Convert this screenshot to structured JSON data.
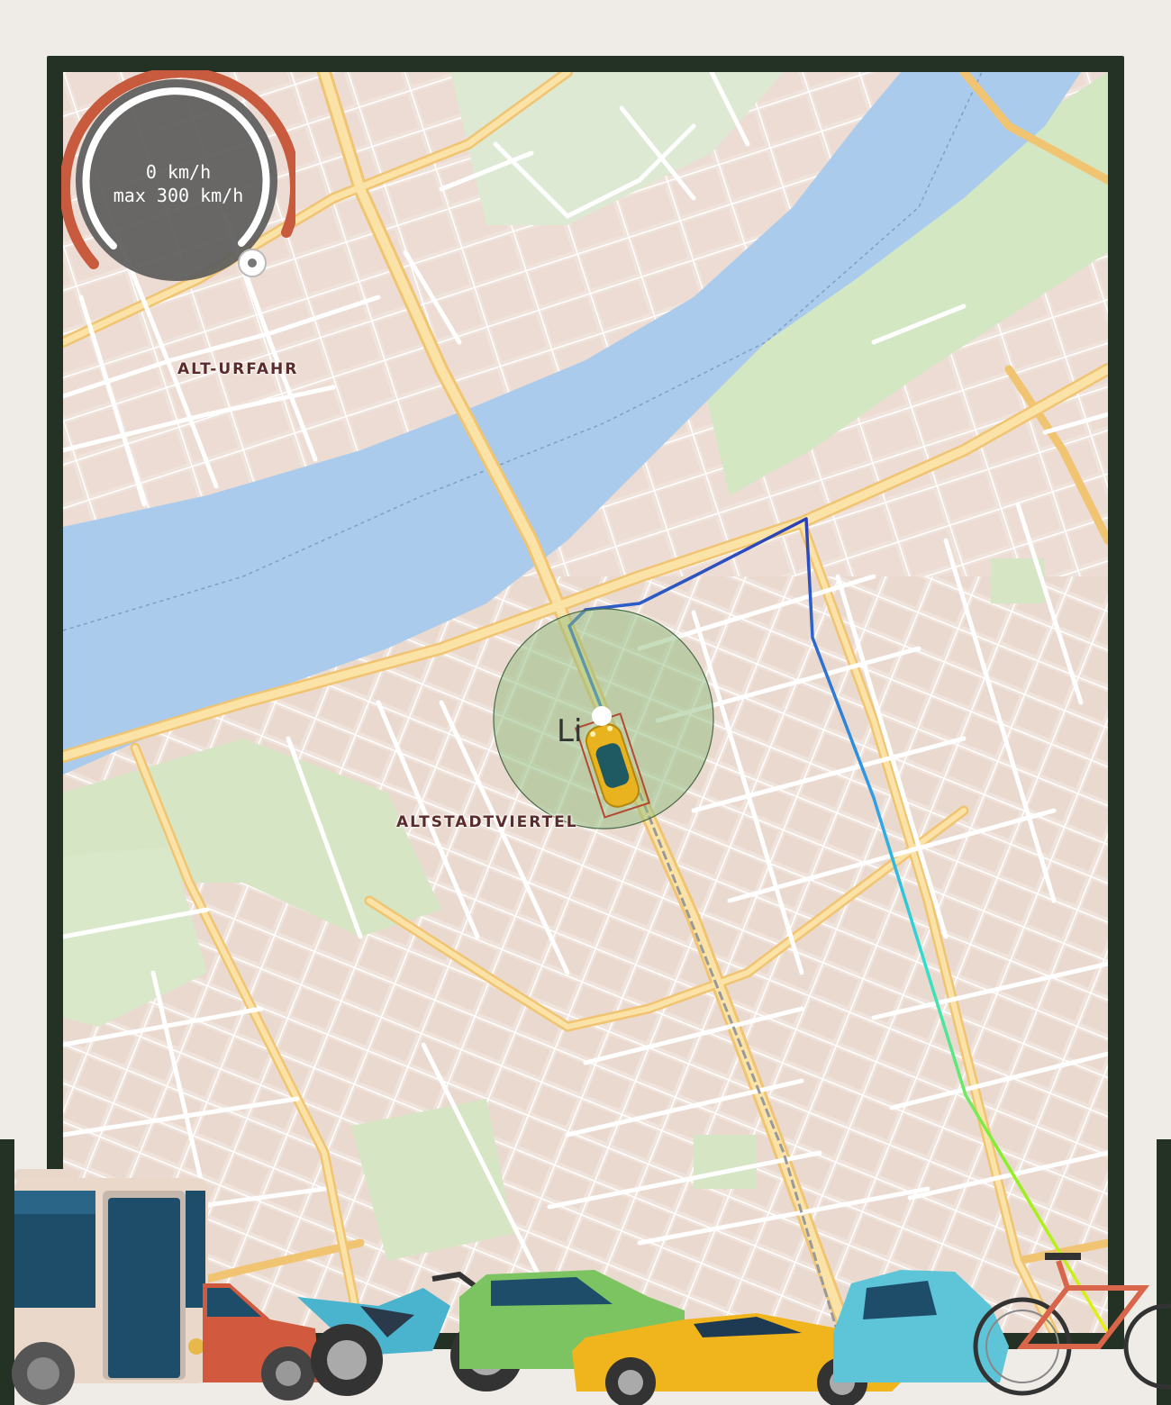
{
  "speedometer": {
    "current": "0 km/h",
    "max": "max 300 km/h",
    "value_kmh": 0,
    "max_kmh": 300
  },
  "map": {
    "districts": [
      "ALT-URFAHR",
      "ALTSTADTVIERTEL"
    ],
    "city": "Li",
    "colors": {
      "land": "#f2ebe4",
      "water": "#aacbec",
      "park": "#cfe7c0",
      "road_major": "#f6cf7c",
      "road_minor": "#ffffff",
      "route_start": "#2b3fb8",
      "route_mid": "#2fe0e8",
      "route_end": "#d7f018",
      "radius": "#8fbd7d"
    }
  },
  "vehicles": [
    "bus-icon",
    "red-car-icon",
    "motorbike-icon",
    "green-car-icon",
    "sports-car-icon",
    "blue-car-icon",
    "bicycle-icon"
  ]
}
